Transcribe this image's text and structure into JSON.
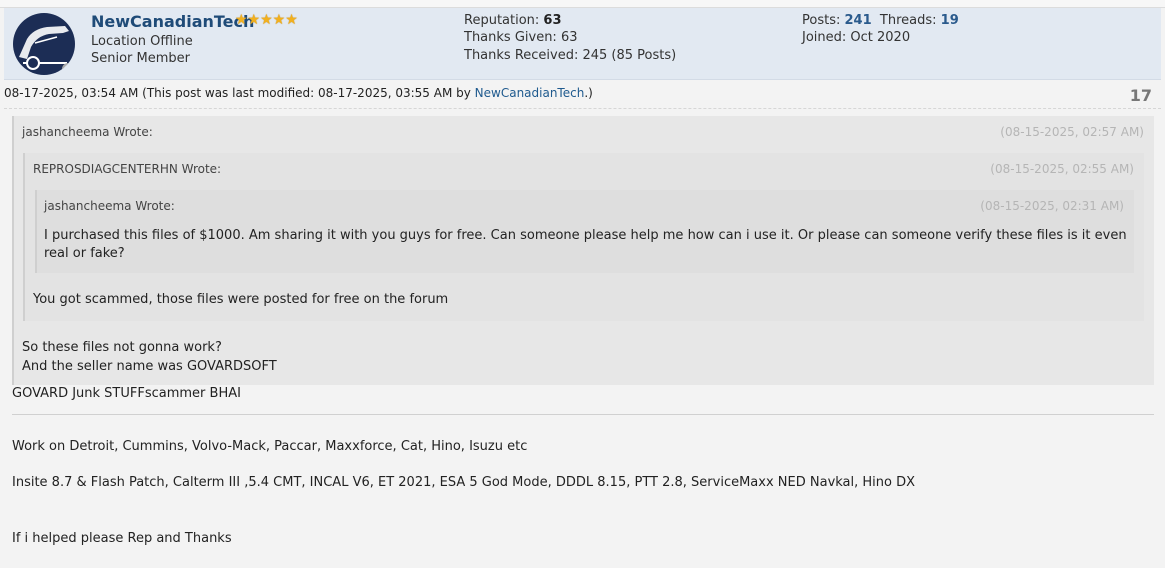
{
  "user": {
    "name": "NewCanadianTech",
    "stars": "★★★★★",
    "location": "Location Offline",
    "rank": "Senior Member"
  },
  "stats": {
    "reputation_label": "Reputation: ",
    "reputation_value": "63",
    "thanks_given": "Thanks Given: 63",
    "thanks_received": "Thanks Received: 245 (85 Posts)",
    "posts_label": "Posts: ",
    "posts_value": "241",
    "threads_label": "Threads: ",
    "threads_value": "19",
    "joined": "Joined: Oct 2020"
  },
  "post": {
    "meta_prefix": "08-17-2025, 03:54 AM (This post was last modified: 08-17-2025, 03:55 AM by ",
    "meta_link": "NewCanadianTech",
    "meta_suffix": ".)",
    "number": "17"
  },
  "quotes": [
    {
      "author": "jashancheema Wrote:",
      "date": "(08-15-2025, 02:57 AM)"
    },
    {
      "author": "REPROSDIAGCENTERHN Wrote:",
      "date": "(08-15-2025, 02:55 AM)"
    },
    {
      "author": "jashancheema Wrote:",
      "date": "(08-15-2025, 02:31 AM)",
      "text": "I purchased this files of $1000. Am sharing it with you guys for free. Can someone please help me how can i use it. Or please can someone verify these files is it even real or fake?"
    }
  ],
  "quote2_text": "You got scammed, those files were posted for free on the forum",
  "quote1_text_1": "So these files not gonna work?",
  "quote1_text_2": "And the seller name was GOVARDSOFT",
  "reply": "GOVARD Junk STUFFscammer BHAI",
  "signature": {
    "line1": "Work on Detroit, Cummins, Volvo-Mack, Paccar, Maxxforce, Cat, Hino, Isuzu etc",
    "line2": "Insite 8.7 & Flash Patch, Calterm III ,5.4 CMT, INCAL V6, ET 2021, ESA 5 God Mode, DDDL 8.15, PTT 2.8, ServiceMaxx NED Navkal, Hino DX",
    "line3": "If i helped please Rep and Thanks"
  }
}
